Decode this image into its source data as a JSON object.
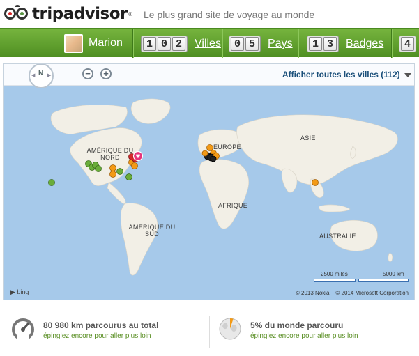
{
  "header": {
    "logo_text": "tripadvisor",
    "logo_reg": "®",
    "tagline": "Le plus grand site de voyage au monde"
  },
  "user": {
    "name": "Marion"
  },
  "stats": [
    {
      "digits": [
        "1",
        "0",
        "2"
      ],
      "label": "Villes"
    },
    {
      "digits": [
        "0",
        "5"
      ],
      "label": "Pays"
    },
    {
      "digits": [
        "1",
        "3"
      ],
      "label": "Badges"
    },
    {
      "digits": [
        "4"
      ],
      "label": ""
    }
  ],
  "map": {
    "compass_label": "N",
    "zoom_out": "−",
    "zoom_in": "+",
    "cities_toggle": "Afficher toutes les villes",
    "cities_count": "(112)",
    "labels": {
      "north_america": "AMÉRIQUE DU NORD",
      "europe": "EUROPE",
      "asia": "ASIE",
      "africa": "AFRIQUE",
      "south_america": "AMÉRIQUE DU SUD",
      "australia": "AUSTRALIE"
    },
    "scale_miles": "2500 miles",
    "scale_km": "5000 km",
    "copyright_nokia": "© 2013 Nokia",
    "copyright_ms": "© 2014 Microsoft Corporation",
    "bing": "bing",
    "pin_colors": {
      "visited": "#f39a16",
      "want": "#6aad3a",
      "fav": "#e7357b",
      "home": "#222222"
    }
  },
  "footer": {
    "distance": {
      "title": "80 980 km parcourus au total",
      "sub": "épinglez encore pour aller plus loin"
    },
    "world": {
      "title": "5% du monde parcouru",
      "sub": "épinglez encore pour aller plus loin"
    }
  }
}
